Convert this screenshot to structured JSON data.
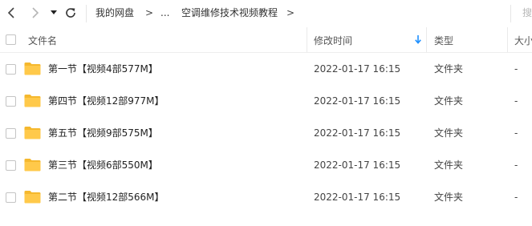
{
  "toolbar": {
    "icons": {
      "back": "chevron-left-icon",
      "forward": "chevron-right-icon",
      "history": "caret-down-icon",
      "refresh": "refresh-icon"
    },
    "breadcrumb": [
      "我的网盘",
      ">",
      "...",
      "空调维修技术视频教程",
      ">"
    ],
    "search_hint": "搜"
  },
  "header": {
    "name": "文件名",
    "modified": "修改时间",
    "type": "类型",
    "size": "大小"
  },
  "rows": [
    {
      "name": "第一节【视频4部577M】",
      "modified": "2022-01-17 16:15",
      "type": "文件夹",
      "size": "-"
    },
    {
      "name": "第四节【视频12部977M】",
      "modified": "2022-01-17 16:15",
      "type": "文件夹",
      "size": "-"
    },
    {
      "name": "第五节【视频9部575M】",
      "modified": "2022-01-17 16:15",
      "type": "文件夹",
      "size": "-"
    },
    {
      "name": "第三节【视频6部550M】",
      "modified": "2022-01-17 16:15",
      "type": "文件夹",
      "size": "-"
    },
    {
      "name": "第二节【视频12部566M】",
      "modified": "2022-01-17 16:15",
      "type": "文件夹",
      "size": "-"
    }
  ],
  "colors": {
    "folder": "#ffc94a",
    "folder_dark": "#f5b82e",
    "sort_arrow": "#1e90ff",
    "text": "#333333",
    "divider": "#eaeaea"
  }
}
